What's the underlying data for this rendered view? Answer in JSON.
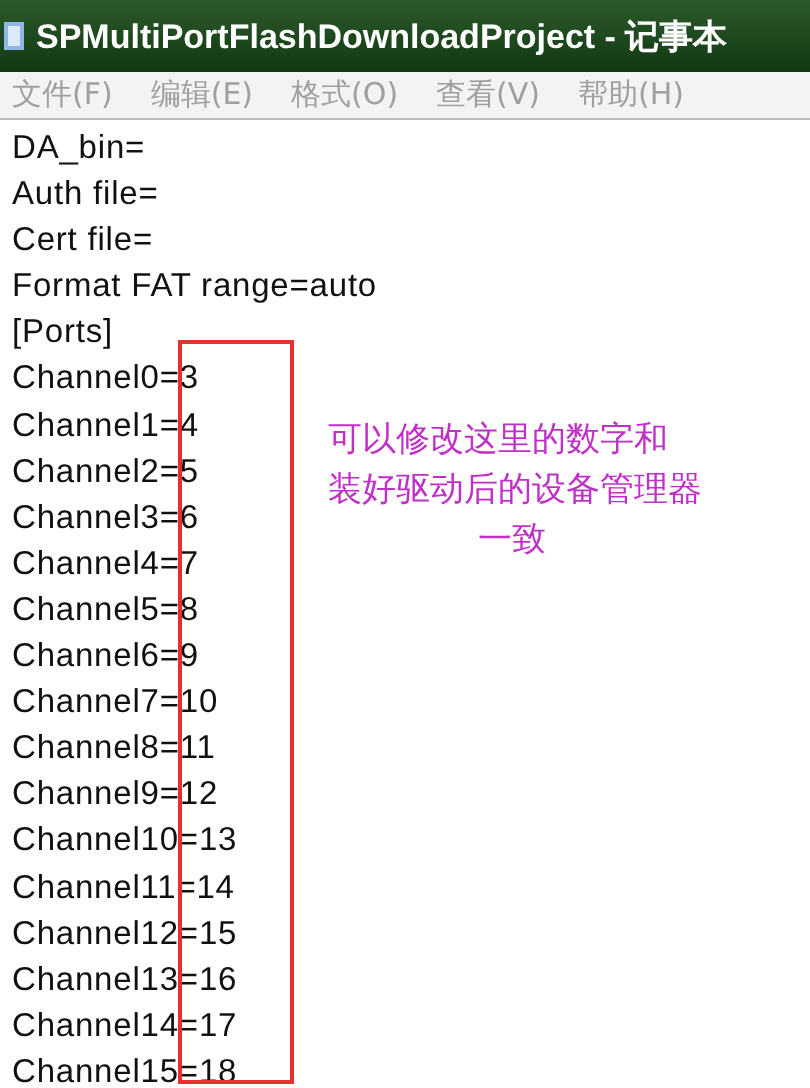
{
  "window": {
    "title": "SPMultiPortFlashDownloadProject - 记事本"
  },
  "menu": [
    "文件(F)",
    "编辑(E)",
    "格式(O)",
    "查看(V)",
    "帮助(H)"
  ],
  "lines": [
    "DA_bin=",
    "Auth file=",
    "Cert file=",
    "Format FAT range=auto",
    "[Ports]",
    "Channel0=3",
    "Channel1=4",
    "Channel2=5",
    "Channel3=6",
    "Channel4=7",
    "Channel5=8",
    "Channel6=9",
    "Channel7=10",
    "Channel8=11",
    "Channel9=12",
    "Channel10=13",
    "Channel11=14",
    "Channel12=15",
    "Channel13=16",
    "Channel14=17",
    "Channel15=18"
  ],
  "annotation": [
    "可以修改这里的数字和",
    "装好驱动后的设备管理器",
    "一致"
  ]
}
